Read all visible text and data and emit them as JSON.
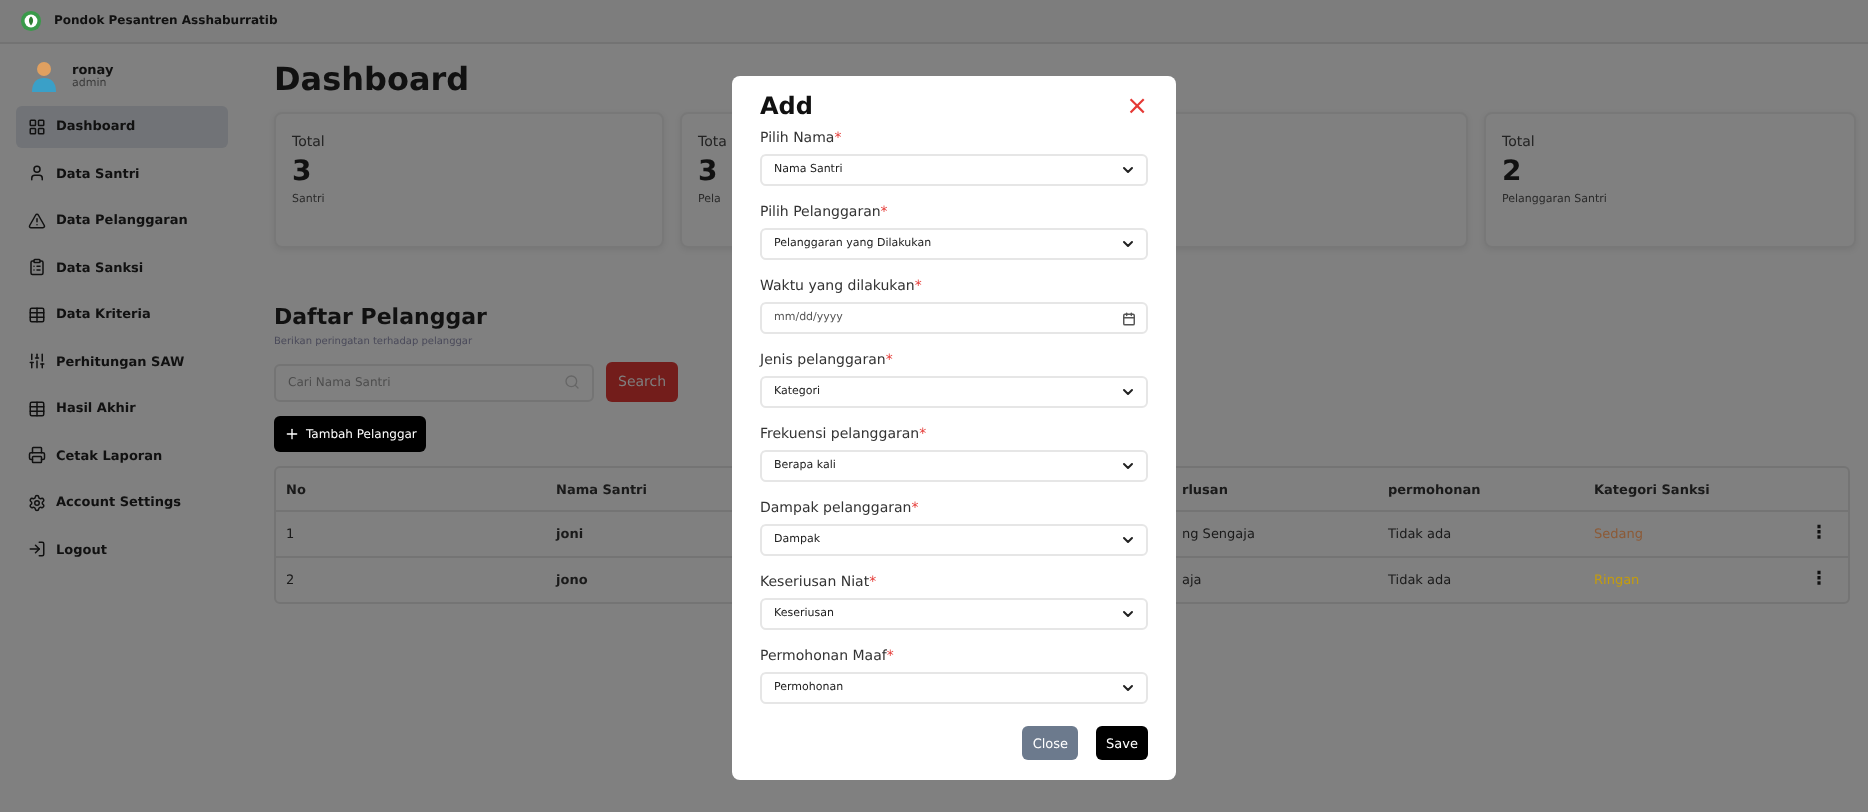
{
  "topbar": {
    "title": "Pondok Pesantren Asshaburratib"
  },
  "user": {
    "name": "ronay",
    "role": "admin"
  },
  "sidebar": {
    "items": [
      {
        "label": "Dashboard",
        "selected": true
      },
      {
        "label": "Data Santri",
        "selected": false
      },
      {
        "label": "Data Pelanggaran",
        "selected": false
      },
      {
        "label": "Data Sanksi",
        "selected": false
      },
      {
        "label": "Data Kriteria",
        "selected": false
      },
      {
        "label": "Perhitungan SAW",
        "selected": false
      },
      {
        "label": "Hasil Akhir",
        "selected": false
      },
      {
        "label": "Cetak Laporan",
        "selected": false
      },
      {
        "label": "Account Settings",
        "selected": false
      },
      {
        "label": "Logout",
        "selected": false
      }
    ]
  },
  "page_title": "Dashboard",
  "stats": [
    {
      "kind": "stat",
      "heading": "Total",
      "value": "3",
      "caption": "Santri"
    },
    {
      "kind": "stat",
      "heading": "Tota",
      "value": "3",
      "caption": "Pela"
    },
    {
      "kind": "blank"
    },
    {
      "kind": "stat",
      "heading": "Total",
      "value": "2",
      "caption": "Pelanggaran Santri"
    }
  ],
  "list": {
    "title": "Daftar Pelanggar",
    "subtitle": "Berikan peringatan terhadap pelanggar",
    "search": {
      "placeholder": "Cari Nama Santri"
    },
    "search_button": "Search",
    "add_button": "Tambah Pelanggar"
  },
  "table": {
    "columns": [
      "No",
      "Nama Santri",
      "rlusan",
      "permohonan",
      "Kategori Sanksi"
    ],
    "rows": [
      {
        "cells": [
          "1",
          "joni",
          "ng Sengaja",
          "Tidak ada",
          "Sedang"
        ],
        "color": "#8c5a36",
        "menu": "⋮"
      },
      {
        "cells": [
          "2",
          "jono",
          "aja",
          "Tidak ada",
          "Ringan"
        ],
        "color": "#c49c0c",
        "menu": "⋮"
      }
    ]
  },
  "modal": {
    "title": "Add",
    "close": "×",
    "fields": [
      {
        "label": "Pilih Nama",
        "required": "*",
        "kind": "select",
        "value": "Nama Santri"
      },
      {
        "label": "Pilih Pelanggaran",
        "required": "*",
        "kind": "select",
        "value": "Pelanggaran yang Dilakukan"
      },
      {
        "label": "Waktu yang dilakukan",
        "required": "*",
        "kind": "date",
        "placeholder": "mm/dd/yyyy"
      },
      {
        "label": "Jenis pelanggaran",
        "required": "*",
        "kind": "select",
        "value": "Kategori"
      },
      {
        "label": "Frekuensi pelanggaran",
        "required": "*",
        "kind": "select",
        "value": "Berapa kali"
      },
      {
        "label": "Dampak pelanggaran",
        "required": "*",
        "kind": "select",
        "value": "Dampak"
      },
      {
        "label": "Keseriusan Niat",
        "required": "*",
        "kind": "select",
        "value": "Keseriusan"
      },
      {
        "label": "Permohonan Maaf",
        "required": "*",
        "kind": "select",
        "value": "Permohonan"
      }
    ],
    "buttons": [
      {
        "label": "Close",
        "kind": "secondary"
      },
      {
        "label": "Save",
        "kind": "primary"
      }
    ]
  }
}
